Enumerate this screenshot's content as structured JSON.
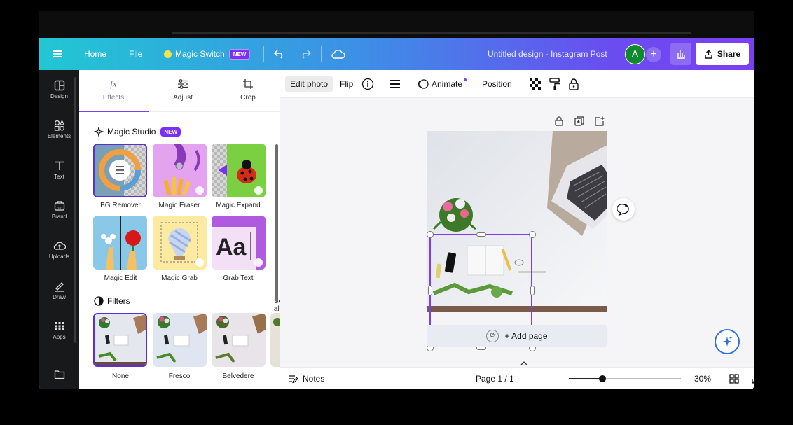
{
  "header": {
    "home_label": "Home",
    "file_label": "File",
    "magic_switch_label": "Magic Switch",
    "new_badge": "NEW",
    "design_title": "Untitled design - Instagram Post",
    "avatar_initial": "A",
    "share_label": "Share",
    "gradient_start": "#21c7d3",
    "gradient_end": "#7b3ff2"
  },
  "sidebar": {
    "items": [
      {
        "label": "Design",
        "icon": "design-icon"
      },
      {
        "label": "Elements",
        "icon": "elements-icon"
      },
      {
        "label": "Text",
        "icon": "text-icon"
      },
      {
        "label": "Brand",
        "icon": "brand-icon"
      },
      {
        "label": "Uploads",
        "icon": "uploads-icon"
      },
      {
        "label": "Draw",
        "icon": "draw-icon"
      },
      {
        "label": "Apps",
        "icon": "apps-icon"
      }
    ]
  },
  "panel": {
    "tabs": [
      {
        "label": "Effects",
        "icon": "fx-icon"
      },
      {
        "label": "Adjust",
        "icon": "sliders-icon"
      },
      {
        "label": "Crop",
        "icon": "crop-icon"
      }
    ],
    "magic_studio_title": "Magic Studio",
    "magic_studio_badge": "NEW",
    "tools": [
      "BG Remover",
      "Magic Eraser",
      "Magic Expand",
      "Magic Edit",
      "Magic Grab",
      "Grab Text"
    ],
    "filters_title": "Filters",
    "see_all": "See all",
    "filters": [
      "None",
      "Fresco",
      "Belvedere"
    ]
  },
  "toolbar": {
    "edit_photo": "Edit photo",
    "flip": "Flip",
    "animate": "Animate",
    "position": "Position"
  },
  "canvas": {
    "add_page": "+ Add page"
  },
  "bottom": {
    "notes": "Notes",
    "page_indicator": "Page 1 / 1",
    "zoom": "30%",
    "zoom_fraction": 0.3
  }
}
